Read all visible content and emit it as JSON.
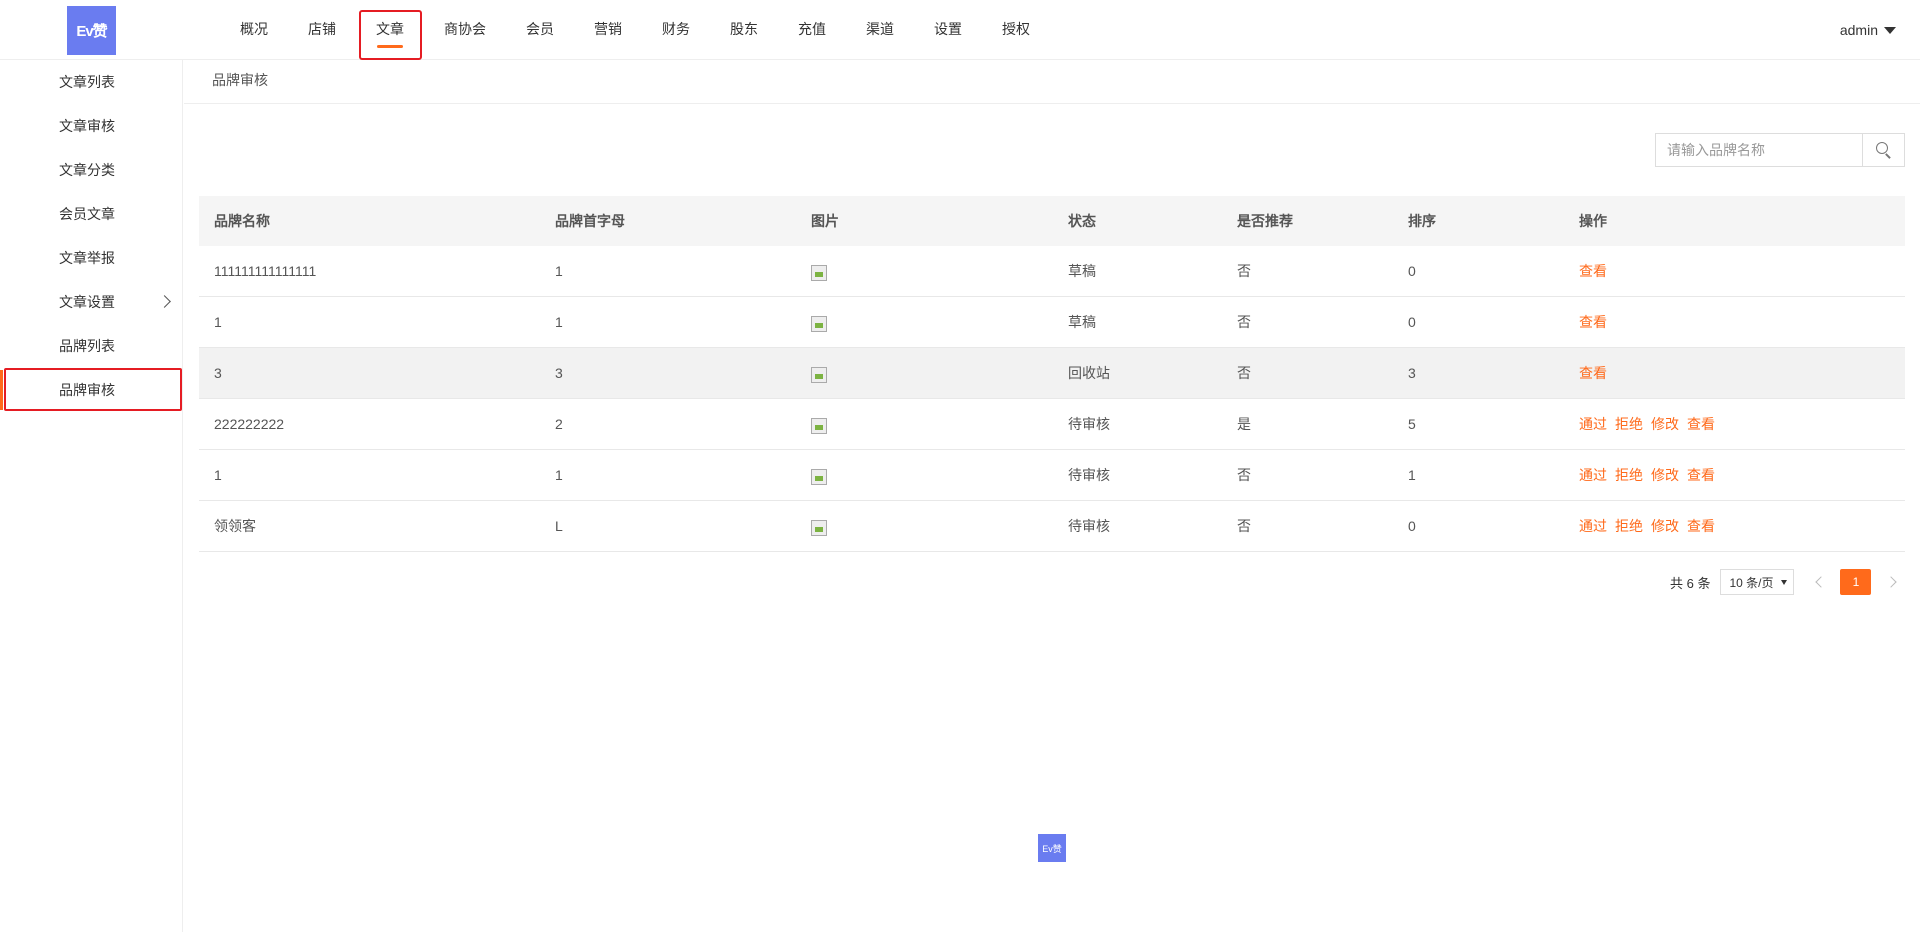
{
  "header": {
    "logo_text": "Ev赞",
    "nav": [
      "概况",
      "店铺",
      "文章",
      "商协会",
      "会员",
      "营销",
      "财务",
      "股东",
      "充值",
      "渠道",
      "设置",
      "授权"
    ],
    "active_nav": "文章",
    "user": "admin"
  },
  "sidebar": {
    "items": [
      {
        "label": "文章列表"
      },
      {
        "label": "文章审核"
      },
      {
        "label": "文章分类"
      },
      {
        "label": "会员文章"
      },
      {
        "label": "文章举报"
      },
      {
        "label": "文章设置",
        "has_children": true
      },
      {
        "label": "品牌列表"
      },
      {
        "label": "品牌审核",
        "active": true
      }
    ]
  },
  "breadcrumb": "品牌审核",
  "search": {
    "placeholder": "请输入品牌名称",
    "value": "",
    "icon": "search-icon"
  },
  "table": {
    "columns": [
      "品牌名称",
      "品牌首字母",
      "图片",
      "状态",
      "是否推荐",
      "排序",
      "操作"
    ],
    "rows": [
      {
        "name": "111111111111111",
        "initial": "1",
        "status": "草稿",
        "recommended": "否",
        "sort": "0",
        "actions": [
          "查看"
        ]
      },
      {
        "name": "1",
        "initial": "1",
        "status": "草稿",
        "recommended": "否",
        "sort": "0",
        "actions": [
          "查看"
        ]
      },
      {
        "name": "3",
        "initial": "3",
        "status": "回收站",
        "recommended": "否",
        "sort": "3",
        "actions": [
          "查看"
        ]
      },
      {
        "name": "222222222",
        "initial": "2",
        "status": "待审核",
        "recommended": "是",
        "sort": "5",
        "actions": [
          "通过",
          "拒绝",
          "修改",
          "查看"
        ]
      },
      {
        "name": "1",
        "initial": "1",
        "status": "待审核",
        "recommended": "否",
        "sort": "1",
        "actions": [
          "通过",
          "拒绝",
          "修改",
          "查看"
        ]
      },
      {
        "name": "领领客",
        "initial": "L",
        "status": "待审核",
        "recommended": "否",
        "sort": "0",
        "actions": [
          "通过",
          "拒绝",
          "修改",
          "查看"
        ]
      }
    ]
  },
  "pagination": {
    "total_text": "共 6 条",
    "per_page": "10 条/页",
    "current_page": "1"
  },
  "footer": {
    "logo_text": "Ev赞"
  },
  "colors": {
    "accent": "#ff6a1b",
    "logo_bg": "#6a7cf0",
    "highlight": "#e51c23"
  }
}
